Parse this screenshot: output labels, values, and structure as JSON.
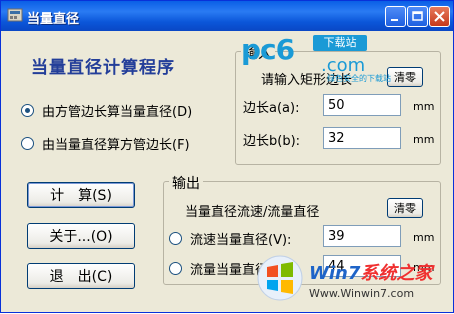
{
  "window": {
    "title": "当量直径"
  },
  "main": {
    "program_title": "当量直径计算程序",
    "modes": [
      {
        "label": "由方管边长算当量直径(D)",
        "selected": true
      },
      {
        "label": "由当量直径算方管边长(F)",
        "selected": false
      }
    ],
    "buttons": {
      "calculate": "计　算(S)",
      "about": "关于...(O)",
      "exit": "退　出(C)"
    }
  },
  "input_group": {
    "legend": "输入",
    "prompt": "请输入矩形边长",
    "clear_label": "清零",
    "side_a_label": "边长a(a):",
    "side_a_value": "50",
    "side_b_label": "边长b(b):",
    "side_b_value": "32",
    "unit": "mm"
  },
  "output_group": {
    "legend": "输出",
    "prompt": "当量直径流速/流量直径",
    "clear_label": "清零",
    "velocity_label": "流速当量直径(V):",
    "velocity_value": "39",
    "flow_label": "流量当量直径(Q):",
    "flow_value": "44",
    "unit": "mm"
  },
  "watermarks": {
    "pc6_text": "pc6",
    "pc6_download": "下载站",
    "pc6_com": ".com",
    "pc6_sub": "绿色安全的下载站",
    "win7_text_a": "Win7",
    "win7_text_b": "系统之家",
    "win7_url": "Www.Winwin7.com"
  }
}
